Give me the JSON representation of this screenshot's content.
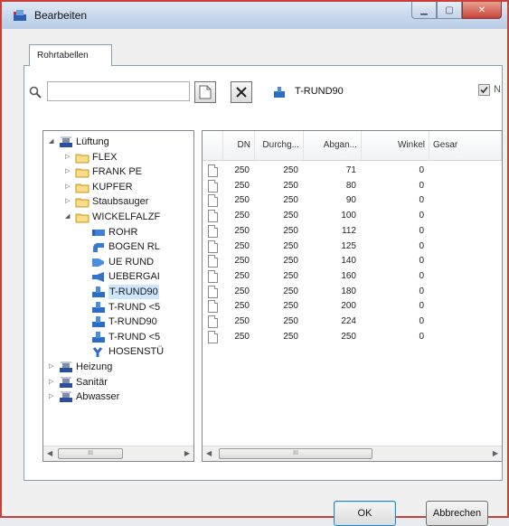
{
  "window": {
    "title": "Bearbeiten"
  },
  "tabs": [
    {
      "label": "Rohrtabellen"
    }
  ],
  "toolbar": {
    "search": {
      "value": "",
      "placeholder": ""
    },
    "table_name": "T-RUND90",
    "checkbox": {
      "checked": true,
      "label": "N"
    }
  },
  "tree": {
    "nodes": [
      {
        "label": "Lüftung",
        "icon": "system-icon",
        "expander": "◢"
      },
      {
        "label": "FLEX",
        "icon": "folder-icon",
        "expander": "▷"
      },
      {
        "label": "FRANK PE",
        "icon": "folder-icon",
        "expander": "▷"
      },
      {
        "label": "KUPFER",
        "icon": "folder-icon",
        "expander": "▷"
      },
      {
        "label": "Staubsauger",
        "icon": "folder-icon",
        "expander": "▷"
      },
      {
        "label": "WICKELFALZF",
        "icon": "folder-icon",
        "expander": "◢"
      },
      {
        "label": "ROHR",
        "icon": "pipe-icon",
        "expander": ""
      },
      {
        "label": "BOGEN RL",
        "icon": "bend-icon",
        "expander": ""
      },
      {
        "label": "UE RUND",
        "icon": "transition-icon",
        "expander": ""
      },
      {
        "label": "UEBERGAI",
        "icon": "reducer-icon",
        "expander": ""
      },
      {
        "label": "T-RUND90",
        "icon": "tee-icon",
        "expander": "",
        "selected": true
      },
      {
        "label": "T-RUND <5",
        "icon": "tee-icon",
        "expander": ""
      },
      {
        "label": "T-RUND90",
        "icon": "tee-icon",
        "expander": ""
      },
      {
        "label": "T-RUND <5",
        "icon": "tee-icon",
        "expander": ""
      },
      {
        "label": "HOSENSTÜ",
        "icon": "y-branch-icon",
        "expander": ""
      },
      {
        "label": "Heizung",
        "icon": "system-icon",
        "expander": "▷"
      },
      {
        "label": "Sanitär",
        "icon": "system-icon",
        "expander": "▷"
      },
      {
        "label": "Abwasser",
        "icon": "system-icon",
        "expander": "▷"
      }
    ],
    "scroll_thumb_label": "III"
  },
  "grid": {
    "columns": [
      "DN",
      "Durchg...",
      "Abgan...",
      "Winkel",
      "Gesar"
    ],
    "rows": [
      [
        "250",
        "250",
        "71",
        "0"
      ],
      [
        "250",
        "250",
        "80",
        "0"
      ],
      [
        "250",
        "250",
        "90",
        "0"
      ],
      [
        "250",
        "250",
        "100",
        "0"
      ],
      [
        "250",
        "250",
        "112",
        "0"
      ],
      [
        "250",
        "250",
        "125",
        "0"
      ],
      [
        "250",
        "250",
        "140",
        "0"
      ],
      [
        "250",
        "250",
        "160",
        "0"
      ],
      [
        "250",
        "250",
        "180",
        "0"
      ],
      [
        "250",
        "250",
        "200",
        "0"
      ],
      [
        "250",
        "250",
        "224",
        "0"
      ],
      [
        "250",
        "250",
        "250",
        "0"
      ]
    ],
    "scroll_thumb_label": "III"
  },
  "buttons": {
    "ok": "OK",
    "cancel": "Abbrechen"
  }
}
